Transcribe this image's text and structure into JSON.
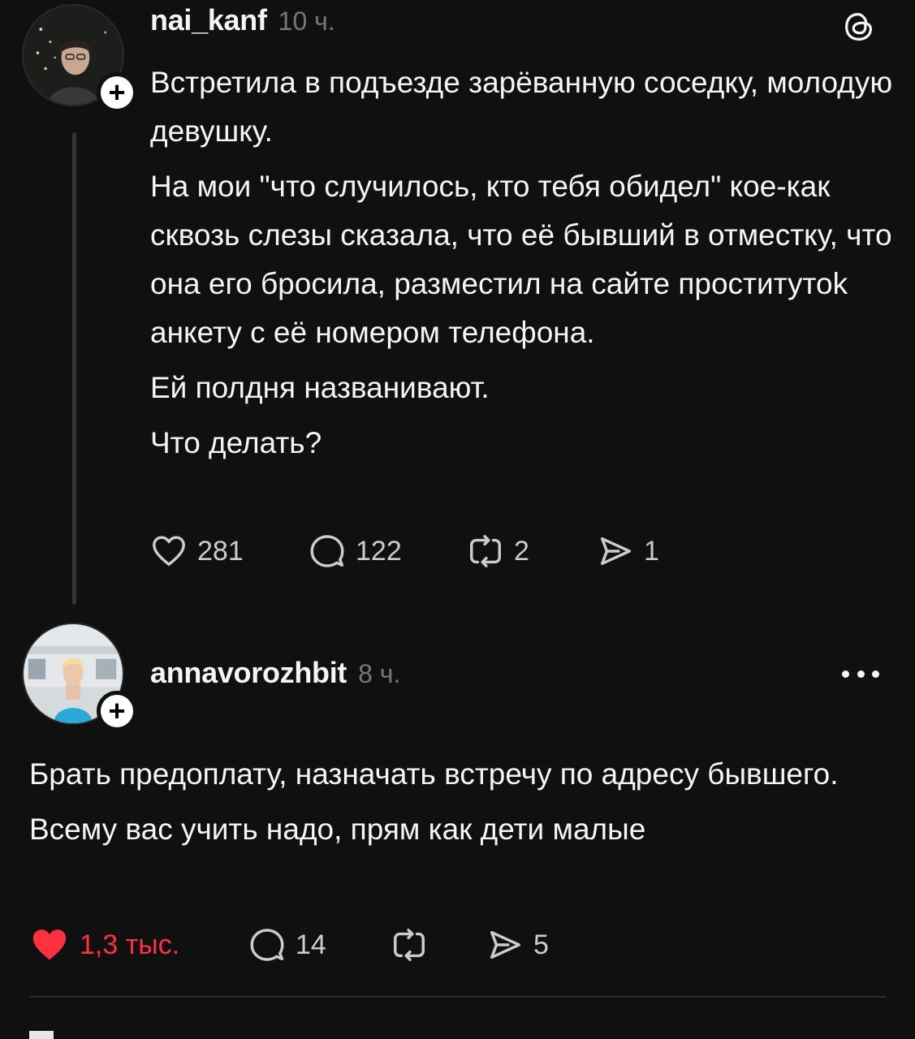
{
  "post": {
    "username": "nai_kanf",
    "time": "10 ч.",
    "paragraphs": [
      "Встретила в подъезде зарёванную соседку, молодую девушку.",
      "На мои \"что случилось, кто тебя обидел\" кое-как сквозь слезы сказала, что её бывший в отместку, что она его бросила, разместил на сайте проститутоk анкету с её номером телефона.",
      "Ей полдня названивают.",
      "Что делать?"
    ],
    "actions": {
      "likes": "281",
      "replies": "122",
      "reposts": "2",
      "shares": "1"
    }
  },
  "reply": {
    "username": "annavorozhbit",
    "time": "8 ч.",
    "paragraphs": [
      "Брать предоплату, назначать встречу по адресу бывшего.",
      "Всему вас учить надо, прям как дети малые"
    ],
    "actions": {
      "likes": "1,3 тыс.",
      "replies": "14",
      "shares": "5"
    }
  },
  "icons": {
    "like": "heart-icon",
    "liked": "heart-filled-icon",
    "reply": "comment-icon",
    "repost": "repost-icon",
    "share": "send-icon",
    "brand": "threads-logo-icon",
    "menu": "more-icon",
    "follow": "plus-icon"
  },
  "colors": {
    "background": "#101010",
    "text": "#f3f5f7",
    "secondary": "#777777",
    "liked": "#ff3040"
  }
}
